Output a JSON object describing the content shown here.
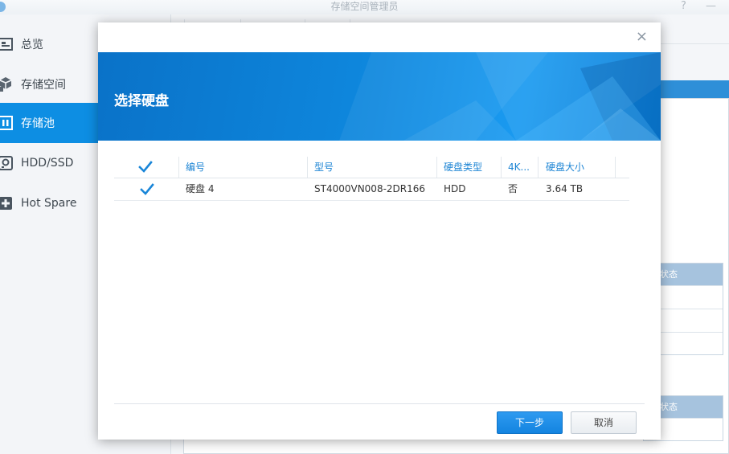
{
  "app": {
    "title": "存储空间管理员",
    "help_label": "?",
    "minimize_label": "—"
  },
  "sidebar": {
    "items": [
      {
        "label": "总览",
        "icon": "overview-icon",
        "active": false
      },
      {
        "label": "存储空间",
        "icon": "storage-space-icon",
        "active": false
      },
      {
        "label": "存储池",
        "icon": "storage-pool-icon",
        "active": true
      },
      {
        "label": "HDD/SSD",
        "icon": "disk-icon",
        "active": false
      },
      {
        "label": "Hot Spare",
        "icon": "hot-spare-icon",
        "active": false
      }
    ]
  },
  "background": {
    "status_header_1": "状态",
    "status_header_2": "状态"
  },
  "dialog": {
    "close_label": "×",
    "title": "选择硬盘",
    "table": {
      "headers": {
        "number": "编号",
        "model": "型号",
        "disk_type": "硬盘类型",
        "fourk": "4K...",
        "size": "硬盘大小"
      },
      "header_checked": true,
      "rows": [
        {
          "checked": true,
          "number": "硬盘 4",
          "model": "ST4000VN008-2DR166",
          "disk_type": "HDD",
          "fourk": "否",
          "size": "3.64 TB"
        }
      ]
    },
    "next_label": "下一步",
    "cancel_label": "取消"
  },
  "colors": {
    "accent": "#0d8ee3",
    "banner": "#0e86dc",
    "header_text": "#1c84d4"
  }
}
